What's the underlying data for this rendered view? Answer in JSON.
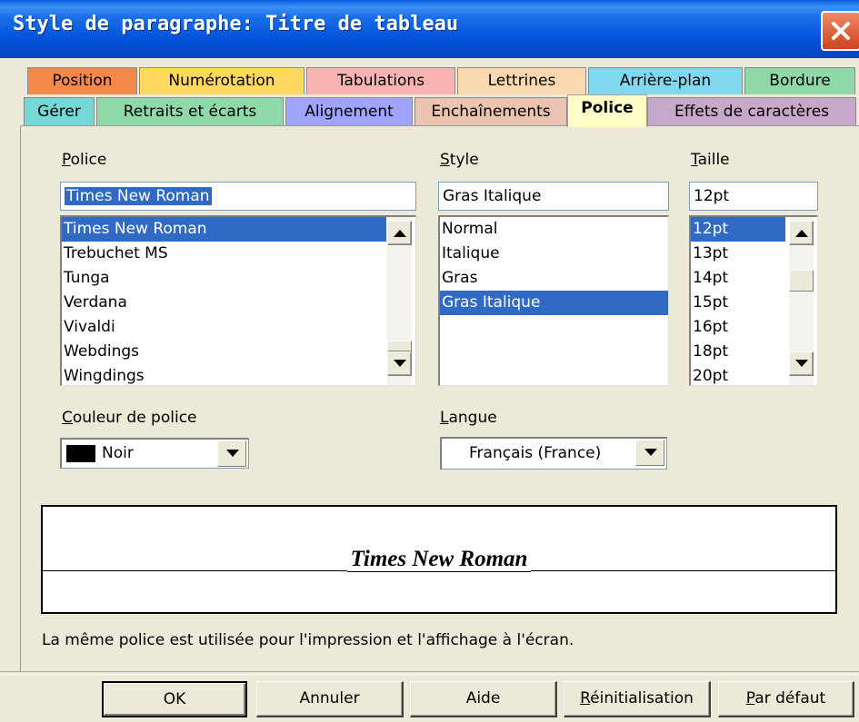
{
  "window": {
    "title": "Style de paragraphe: Titre de tableau"
  },
  "tabs_row1": [
    {
      "label": "Position",
      "color": "#f4884b"
    },
    {
      "label": "Numérotation",
      "color": "#ffd860"
    },
    {
      "label": "Tabulations",
      "color": "#f9b3b3"
    },
    {
      "label": "Lettrines",
      "color": "#fbd9b0"
    },
    {
      "label": "Arrière-plan",
      "color": "#7fd8ee"
    },
    {
      "label": "Bordure",
      "color": "#8fd9a8"
    }
  ],
  "tabs_row2": [
    {
      "label": "Gérer",
      "color": "#76d7d7"
    },
    {
      "label": "Retraits et écarts",
      "color": "#8fd9a8"
    },
    {
      "label": "Alignement",
      "color": "#9ea4ff"
    },
    {
      "label": "Enchaînements",
      "color": "#ecc2b0"
    },
    {
      "label": "Police",
      "color": "#ffffc8",
      "active": true
    },
    {
      "label": "Effets de caractères",
      "color": "#c8a8c8"
    }
  ],
  "font": {
    "label_first": "P",
    "label_rest": "olice",
    "value": "Times New Roman",
    "items": [
      "Times New Roman",
      "Trebuchet MS",
      "Tunga",
      "Verdana",
      "Vivaldi",
      "Webdings",
      "Wingdings"
    ],
    "selected_index": 0
  },
  "style": {
    "label_first": "S",
    "label_rest": "tyle",
    "value": "Gras Italique",
    "items": [
      "Normal",
      "Italique",
      "Gras",
      "Gras Italique"
    ],
    "selected_index": 3
  },
  "size": {
    "label_first": "T",
    "label_rest": "aille",
    "value": "12pt",
    "items": [
      "12pt",
      "13pt",
      "14pt",
      "15pt",
      "16pt",
      "18pt",
      "20pt"
    ],
    "selected_index": 0
  },
  "color": {
    "label_first": "C",
    "label_rest": "ouleur de police",
    "value": "Noir",
    "swatch": "#000000"
  },
  "language": {
    "label_first": "L",
    "label_rest": "angue",
    "value": "Français (France)"
  },
  "preview": {
    "text": "Times New Roman"
  },
  "note": "La même police est utilisée pour l'impression et l'affichage à l'écran.",
  "buttons": {
    "ok": "OK",
    "cancel": "Annuler",
    "help": "Aide",
    "reset_first": "R",
    "reset_rest": "éinitialisation",
    "default_first": "P",
    "default_rest": "ar défaut"
  },
  "colors": {
    "selection": "#316ac5",
    "titlebar": "#0a5ee0",
    "dialog_bg": "#ece9d8"
  }
}
